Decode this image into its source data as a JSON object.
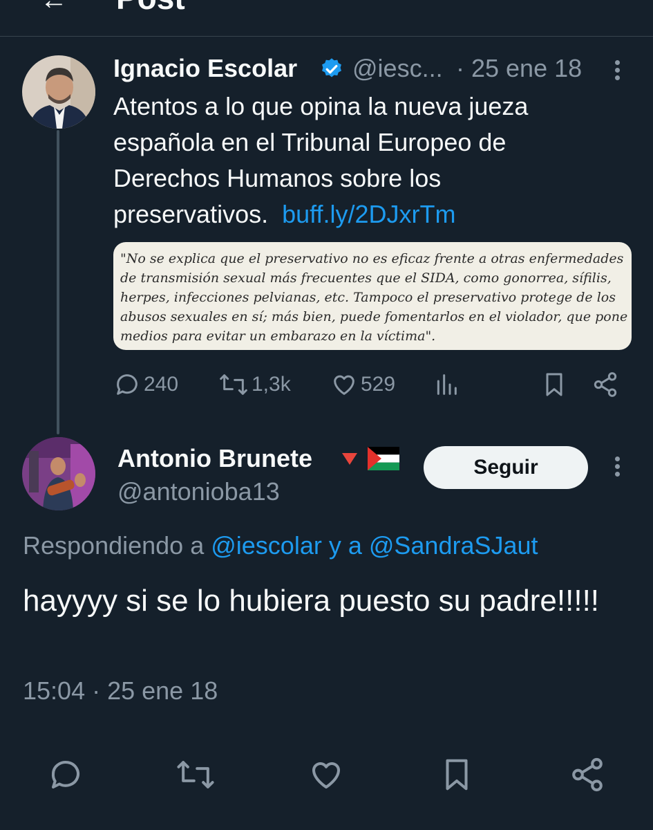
{
  "header": {
    "title": "Post",
    "back_icon": "arrow-left-icon"
  },
  "original_tweet": {
    "author_name": "Ignacio Escolar",
    "verified": true,
    "handle": "@iesc...",
    "date": "· 25 ene 18",
    "text": "Atentos a lo que opina la nueva jueza española en el Tribunal Europeo de Derechos Humanos sobre los preservativos.",
    "link": "buff.ly/2DJxrTm",
    "quote_image_lines": [
      "\"No se explica que el preservativo no es eficaz frente a otras enfermedades",
      "de transmisión sexual más frecuentes que el SIDA, como gonorrea, sífilis,",
      "herpes, infecciones pelvianas, etc. Tampoco el preservativo protege de los",
      "abusos sexuales en sí; más bien, puede fomentarlos en el violador, que pone",
      "medios para evitar un embarazo en la víctima\"."
    ],
    "stats": {
      "replies": "240",
      "retweets": "1,3k",
      "likes": "529"
    }
  },
  "reply_tweet": {
    "author_name": "Antonio Brunete",
    "name_emojis": [
      "down-triangle-icon",
      "palestine-flag-icon"
    ],
    "handle": "@antonioba13",
    "follow_label": "Seguir",
    "replying_prefix": "Respondiendo a",
    "replying_to": "@iescolar y a @SandraSJaut",
    "text": "hayyyy si se lo hubiera puesto su padre!!!!!",
    "timestamp": "15:04 · 25 ene 18"
  },
  "colors": {
    "background": "#15202b",
    "text": "#f7f9f9",
    "muted": "#8b98a5",
    "link": "#1d9bf0",
    "verified": "#1d9bf0",
    "button_bg": "#eff3f4"
  }
}
